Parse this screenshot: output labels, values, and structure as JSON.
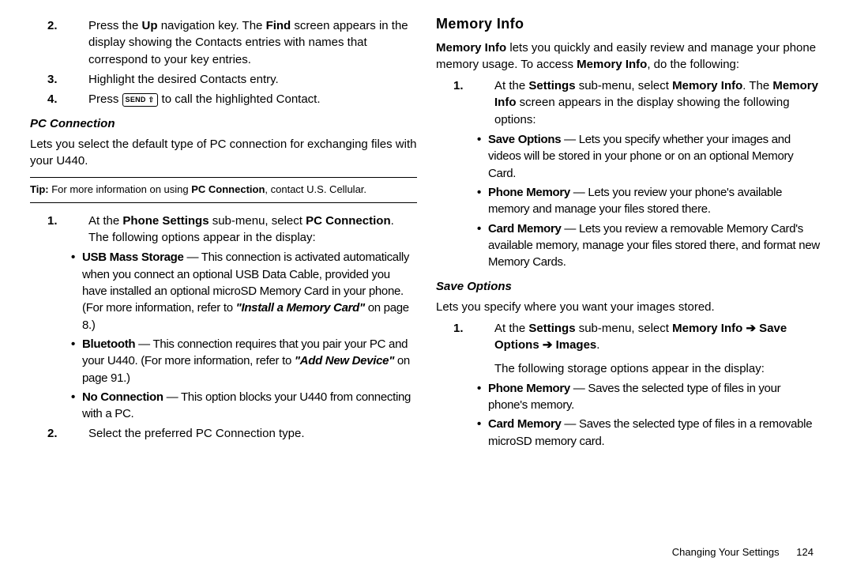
{
  "left": {
    "step2": {
      "num": "2.",
      "pre": "Press the ",
      "bold1": "Up",
      "mid1": " navigation key. The ",
      "bold2": "Find",
      "post": " screen appears in the display showing the Contacts entries with names that correspond to your key entries."
    },
    "step3": {
      "num": "3.",
      "txt": "Highlight the desired Contacts entry."
    },
    "step4": {
      "num": "4.",
      "pre": "Press ",
      "key": "SEND ⇧",
      "post": " to call the highlighted Contact."
    },
    "pc_head": "PC Connection",
    "pc_intro": "Lets you select the default type of PC connection for exchanging files with your U440.",
    "tip": {
      "pre": "Tip: ",
      "mid": "For more information on using ",
      "bold": "PC Connection",
      "post": ", contact U.S. Cellular."
    },
    "pc_step1": {
      "num": "1.",
      "pre": "At the ",
      "bold1": "Phone Settings",
      "mid": " sub-menu, select ",
      "bold2": "PC Connection",
      "post1": ". The following options appear in the display:"
    },
    "pc_b1": {
      "bold": "USB Mass Storage",
      "dash": " — ",
      "txt1": "This connection is activated automatically when you connect an optional USB Data Cable, provided you have installed an optional microSD Memory Card in your phone. (For more information, refer to ",
      "ital": "\"Install a Memory Card\"",
      "txt2": "  on page 8.)"
    },
    "pc_b2": {
      "bold": "Bluetooth",
      "dash": " — ",
      "txt1": "This connection requires that you pair your PC and your U440. (For more information, refer to ",
      "ital": "\"Add New Device\"",
      "txt2": "  on page 91.)"
    },
    "pc_b3": {
      "bold": "No Connection",
      "dash": " — ",
      "txt": "This option blocks your U440 from connecting with a PC."
    },
    "pc_step2": {
      "num": "2.",
      "txt": "Select the preferred PC Connection type."
    }
  },
  "right": {
    "mem_head": "Memory Info",
    "mem_intro": {
      "bold": "Memory Info",
      "mid": " lets you quickly and easily review and manage your phone memory usage. To access ",
      "bold2": "Memory Info",
      "post": ", do the following:"
    },
    "mem_step1": {
      "num": "1.",
      "pre": "At the ",
      "bold1": "Settings",
      "mid1": " sub-menu, select ",
      "bold2": "Memory Info",
      "mid2": ". The ",
      "bold3": "Memory Info",
      "post": " screen appears in the display showing the following options:"
    },
    "mem_b1": {
      "bold": "Save Options",
      "dash": " — ",
      "txt": "Lets you specify whether your images and videos will be stored in your phone or on an optional Memory Card."
    },
    "mem_b2": {
      "bold": "Phone Memory",
      "dash": " — ",
      "txt": "Lets you review your phone's available memory and manage your files stored there."
    },
    "mem_b3": {
      "bold": "Card Memory",
      "dash": " — ",
      "txt": "Lets you review a removable Memory Card's available memory, manage your files stored there, and format new Memory Cards."
    },
    "save_head": "Save Options",
    "save_intro": "Lets you specify where you want your images stored.",
    "save_step1": {
      "num": "1.",
      "pre": "At the ",
      "bold1": "Settings",
      "mid1": " sub-menu, select ",
      "bold2": "Memory Info ➔ Save Options ➔ Images",
      "post1": ".",
      "line2": "The following storage options appear in the display:"
    },
    "save_b1": {
      "bold": "Phone Memory",
      "dash": " — ",
      "txt": "Saves the selected type of files in your phone's memory."
    },
    "save_b2": {
      "bold": "Card Memory",
      "dash": " — ",
      "txt": "Saves the selected type of files in a removable microSD memory card."
    }
  },
  "footer": {
    "chapter": "Changing Your Settings",
    "page": "124"
  }
}
